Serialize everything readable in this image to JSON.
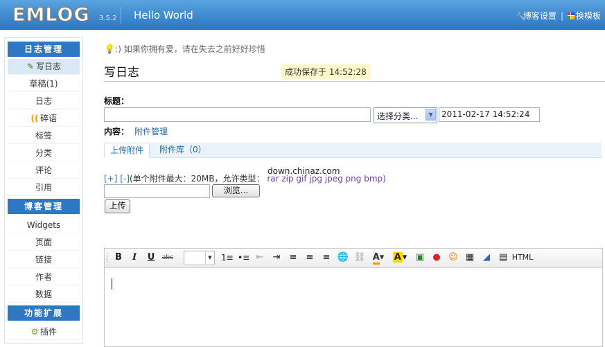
{
  "header": {
    "logo": "EMLOG",
    "version": "3.5.2",
    "site_title": "Hello World",
    "links": [
      {
        "label": "博客设置",
        "icon": "wrench-icon"
      },
      {
        "label": "换模板",
        "icon": "grid-icon"
      }
    ],
    "separator": "|"
  },
  "sidebar": {
    "sections": [
      {
        "title": "日志管理",
        "items": [
          "写日志",
          "草稿(1)",
          "日志",
          "碎语",
          "标签",
          "分类",
          "评论",
          "引用"
        ]
      },
      {
        "title": "博客管理",
        "items": [
          "Widgets",
          "页面",
          "链接",
          "作者",
          "数据"
        ]
      },
      {
        "title": "功能扩展",
        "items": [
          "插件"
        ]
      }
    ],
    "active_item": "写日志"
  },
  "main": {
    "tip": ":) 如果你拥有爱，请在失去之前好好珍惜",
    "page_title": "写日志",
    "save_message": "成功保存于  14:52:28",
    "title_label": "标题：",
    "title_value": "",
    "category_select": "选择分类...",
    "date_value": "2011-02-17 14:52:24",
    "content_label": "内容：",
    "attachment_link": "附件管理",
    "attachment_tabs": [
      "上传附件",
      "附件库（0）"
    ],
    "upload": {
      "plus_minus": "[+] [-]",
      "limit_text": "(单个附件最大：20MB，允许类型：",
      "types": "rar zip gif jpg jpeg png bmp)",
      "watermark": "down.chinaz.com",
      "browse_label": "浏览...",
      "upload_label": "上传"
    },
    "editor": {
      "toolbar": {
        "bold": "B",
        "italic": "I",
        "underline": "U",
        "strikethrough": "abc",
        "html": "HTML"
      },
      "content": ""
    }
  }
}
